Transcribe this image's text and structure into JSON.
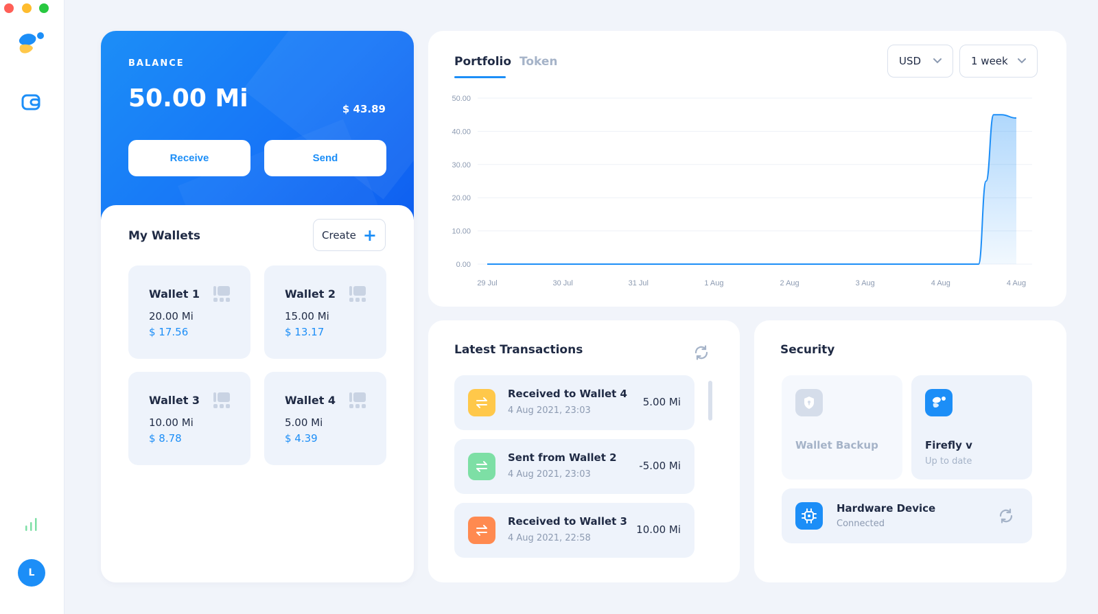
{
  "sidebar": {
    "avatar_initial": "L"
  },
  "balance": {
    "label": "BALANCE",
    "amount": "50.00 Mi",
    "fiat": "$ 43.89",
    "receive_label": "Receive",
    "send_label": "Send"
  },
  "wallets": {
    "title": "My Wallets",
    "create_label": "Create",
    "items": [
      {
        "name": "Wallet 1",
        "balance": "20.00 Mi",
        "fiat": "$ 17.56"
      },
      {
        "name": "Wallet 2",
        "balance": "15.00 Mi",
        "fiat": "$ 13.17"
      },
      {
        "name": "Wallet 3",
        "balance": "10.00 Mi",
        "fiat": "$ 8.78"
      },
      {
        "name": "Wallet 4",
        "balance": "5.00 Mi",
        "fiat": "$ 4.39"
      }
    ]
  },
  "portfolio": {
    "tabs": [
      {
        "label": "Portfolio",
        "active": true
      },
      {
        "label": "Token",
        "active": false
      }
    ],
    "currency": "USD",
    "period": "1 week"
  },
  "chart_data": {
    "type": "area",
    "title": "",
    "xlabel": "",
    "ylabel": "",
    "ylim": [
      0,
      50
    ],
    "yticks": [
      "0.00",
      "10.00",
      "20.00",
      "30.00",
      "40.00",
      "50.00"
    ],
    "xticks": [
      "29 Jul",
      "30 Jul",
      "31 Jul",
      "1 Aug",
      "2 Aug",
      "3 Aug",
      "4 Aug",
      "4 Aug"
    ],
    "grid": true,
    "series": [
      {
        "x": [
          0,
          1,
          2,
          3,
          4,
          5,
          6,
          6.5,
          6.6,
          6.7,
          6.8,
          7
        ],
        "values": [
          0,
          0,
          0,
          0,
          0,
          0,
          0,
          0,
          25,
          45,
          45,
          44
        ]
      }
    ],
    "color": "#1C8EF7"
  },
  "transactions": {
    "title": "Latest Transactions",
    "items": [
      {
        "title": "Received to Wallet 4",
        "date": "4 Aug 2021, 23:03",
        "amount": "5.00 Mi",
        "color": "#FFC84A"
      },
      {
        "title": "Sent from Wallet 2",
        "date": "4 Aug 2021, 23:03",
        "amount": "-5.00 Mi",
        "color": "#7DDFA5"
      },
      {
        "title": "Received to Wallet 3",
        "date": "4 Aug 2021, 22:58",
        "amount": "10.00 Mi",
        "color": "#FF8A50"
      }
    ]
  },
  "security": {
    "title": "Security",
    "backup_label": "Wallet Backup",
    "firefly_title": "Firefly v",
    "firefly_sub": "Up to date",
    "hardware_title": "Hardware Device",
    "hardware_sub": "Connected"
  },
  "colors": {
    "accent": "#1C8EF7",
    "background": "#F1F4FA",
    "card": "#EEF3FB"
  }
}
